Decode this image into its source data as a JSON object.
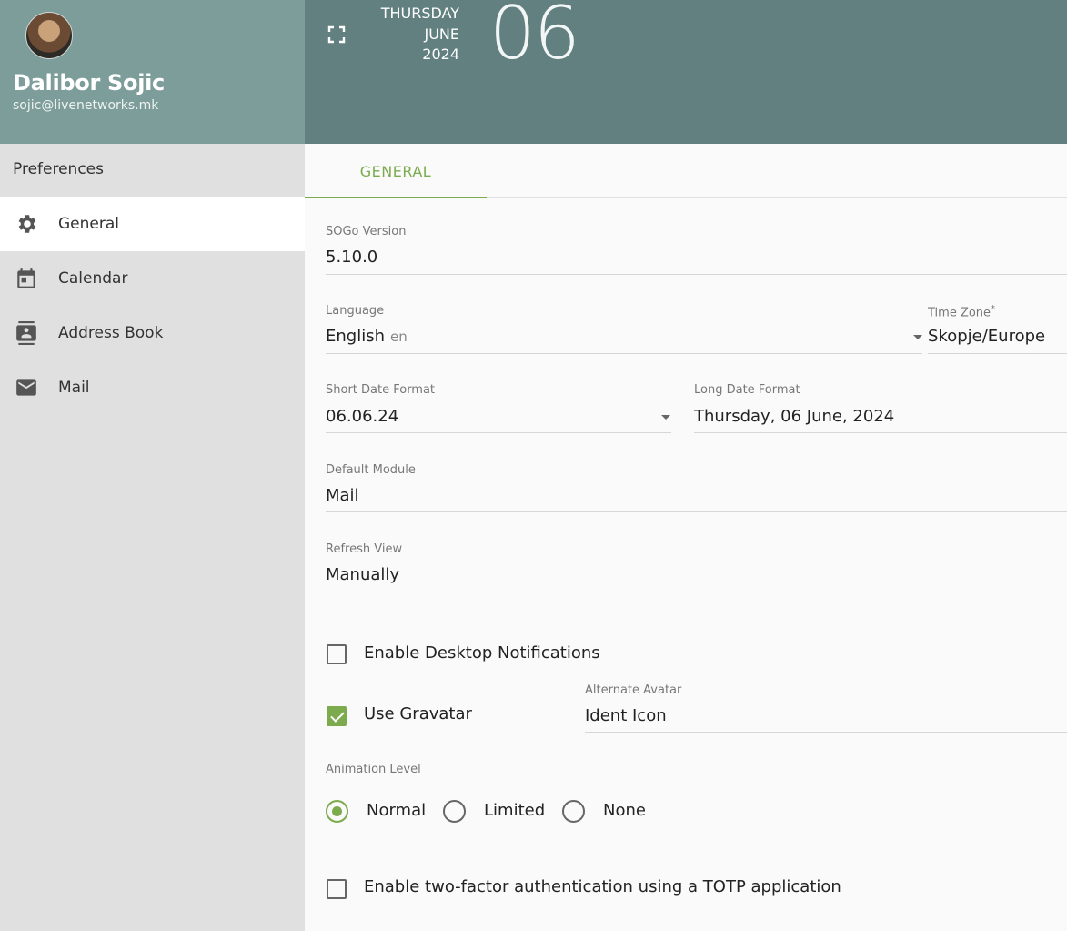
{
  "user": {
    "name": "Dalibor Sojic",
    "email": "sojic@livenetworks.mk"
  },
  "date": {
    "weekday": "THURSDAY",
    "month": "JUNE",
    "year": "2024",
    "day": "06"
  },
  "sidebar": {
    "title": "Preferences",
    "items": [
      {
        "label": "General",
        "icon": "gear-icon",
        "active": true
      },
      {
        "label": "Calendar",
        "icon": "calendar-icon",
        "active": false
      },
      {
        "label": "Address Book",
        "icon": "contacts-icon",
        "active": false
      },
      {
        "label": "Mail",
        "icon": "mail-icon",
        "active": false
      }
    ]
  },
  "tabs": [
    {
      "label": "GENERAL",
      "active": true
    }
  ],
  "form": {
    "sogo_version": {
      "label": "SOGo Version",
      "value": "5.10.0"
    },
    "language": {
      "label": "Language",
      "value": "English",
      "hint": "en"
    },
    "timezone": {
      "label": "Time Zone",
      "required_mark": "*",
      "value": "Skopje/Europe"
    },
    "short_date": {
      "label": "Short Date Format",
      "value": "06.06.24"
    },
    "long_date": {
      "label": "Long Date Format",
      "value": "Thursday, 06 June, 2024"
    },
    "default_module": {
      "label": "Default Module",
      "value": "Mail"
    },
    "refresh_view": {
      "label": "Refresh View",
      "value": "Manually"
    },
    "desktop_notifications": {
      "label": "Enable Desktop Notifications",
      "checked": false
    },
    "gravatar": {
      "label": "Use Gravatar",
      "checked": true
    },
    "alternate_avatar": {
      "label": "Alternate Avatar",
      "value": "Ident Icon"
    },
    "animation": {
      "label": "Animation Level",
      "options": [
        "Normal",
        "Limited",
        "None"
      ],
      "selected": "Normal"
    },
    "totp": {
      "label": "Enable two-factor authentication using a TOTP application",
      "checked": false
    }
  },
  "colors": {
    "accent": "#7cab4d",
    "header": "#628080",
    "user_header": "#7d9d9b"
  }
}
